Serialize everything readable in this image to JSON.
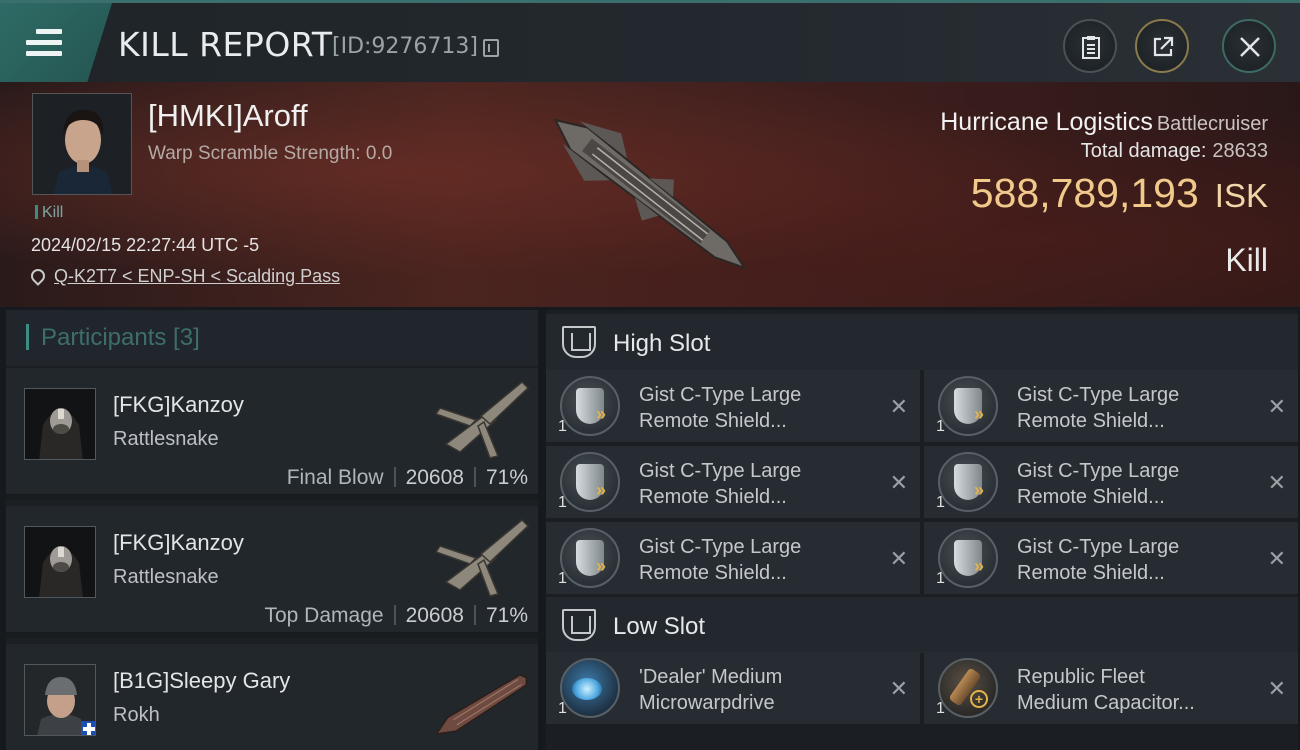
{
  "titlebar": {
    "title": "KILL REPORT",
    "report_id": "[ID:9276713]"
  },
  "victim": {
    "pilot_name": "[HMKI]Aroff",
    "warp_scramble": "Warp Scramble Strength: 0.0",
    "tag": "Kill",
    "datetime": "2024/02/15 22:27:44 UTC -5",
    "location": "Q-K2T7 < ENP-SH < Scalding Pass",
    "ship_name": "Hurricane Logistics",
    "ship_class": "Battlecruiser",
    "total_damage_label": "Total damage:",
    "total_damage": "28633",
    "isk_value": "588,789,193",
    "isk_unit": "ISK",
    "result": "Kill"
  },
  "participants": {
    "header": "Participants [3]",
    "rows": [
      {
        "name": "[FKG]Kanzoy",
        "ship": "Rattlesnake",
        "label": "Final Blow",
        "damage": "20608",
        "percent": "71%"
      },
      {
        "name": "[FKG]Kanzoy",
        "ship": "Rattlesnake",
        "label": "Top Damage",
        "damage": "20608",
        "percent": "71%"
      },
      {
        "name": "[B1G]Sleepy Gary",
        "ship": "Rokh",
        "label": "",
        "damage": "",
        "percent": ""
      }
    ]
  },
  "fitting": {
    "high_slot_label": "High Slot",
    "low_slot_label": "Low Slot",
    "high": [
      {
        "line1": "Gist C-Type Large",
        "line2": "Remote Shield...",
        "qty": "1"
      },
      {
        "line1": "Gist C-Type Large",
        "line2": "Remote Shield...",
        "qty": "1"
      },
      {
        "line1": "Gist C-Type Large",
        "line2": "Remote Shield...",
        "qty": "1"
      },
      {
        "line1": "Gist C-Type Large",
        "line2": "Remote Shield...",
        "qty": "1"
      },
      {
        "line1": "Gist C-Type Large",
        "line2": "Remote Shield...",
        "qty": "1"
      },
      {
        "line1": "Gist C-Type Large",
        "line2": "Remote Shield...",
        "qty": "1"
      }
    ],
    "low": [
      {
        "line1": "'Dealer' Medium",
        "line2": "Microwarpdrive",
        "qty": "1"
      },
      {
        "line1": "Republic Fleet",
        "line2": "Medium Capacitor...",
        "qty": "1"
      }
    ]
  }
}
